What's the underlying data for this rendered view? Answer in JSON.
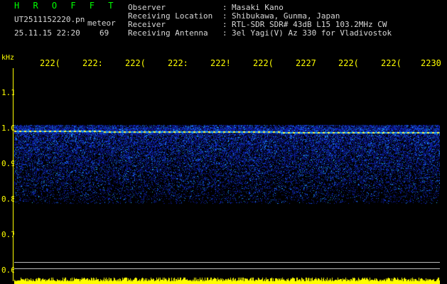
{
  "header": {
    "logo": "H R O F F T",
    "filename": "UT2511152220.pn",
    "tag": "meteor",
    "datetime": "25.11.15 22:20",
    "count": "69",
    "labels": [
      "Observer",
      "Receiving Location",
      "Receiver",
      "Receiving Antenna"
    ],
    "values": [
      "Masaki Kano",
      "Shibukawa, Gunma, Japan",
      "RTL-SDR SDR# 43dB L15 103.2MHz CW",
      "3el Yagi(V) Az 330 for Vladivostok"
    ]
  },
  "axis": {
    "unit": "kHz",
    "x_ticks": [
      "222(",
      "222:",
      "222(",
      "222:",
      "222!",
      "222(",
      "2227",
      "222(",
      "222(",
      "2230"
    ],
    "y_ticks": [
      "1.1",
      "1.0",
      "0.9",
      "0.8",
      "0.7",
      "0.6"
    ]
  },
  "colors": {
    "background": "#000000",
    "axis_text": "#ffff00",
    "logo": "#00ff00",
    "text": "#d8d8d8",
    "signal_low": "#1020c0",
    "signal_mid": "#1fa0ff",
    "signal_high": "#ffff40",
    "baseline_bar": "#ffff00"
  }
}
